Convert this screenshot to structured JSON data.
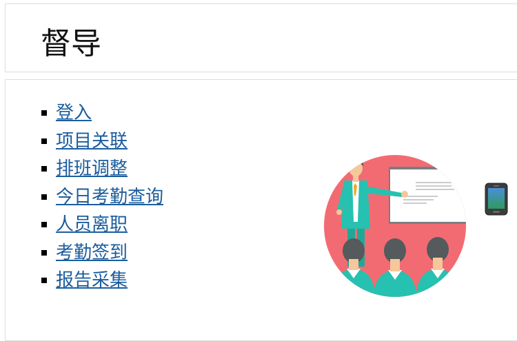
{
  "header": {
    "title": "督导"
  },
  "menu": {
    "items": [
      {
        "label": "登入"
      },
      {
        "label": "项目关联"
      },
      {
        "label": "排班调整"
      },
      {
        "label": "今日考勤查询"
      },
      {
        "label": "人员离职"
      },
      {
        "label": "考勤签到"
      },
      {
        "label": "报告采集"
      }
    ]
  },
  "illustration": {
    "icon": "presentation-illustration"
  },
  "phone": {
    "icon": "mobile-phone-icon"
  },
  "colors": {
    "link": "#1a5c9e",
    "circle": "#f36b72",
    "suit": "#26c1b0",
    "hair": "#555a5c",
    "board_frame": "#7a7d80"
  }
}
